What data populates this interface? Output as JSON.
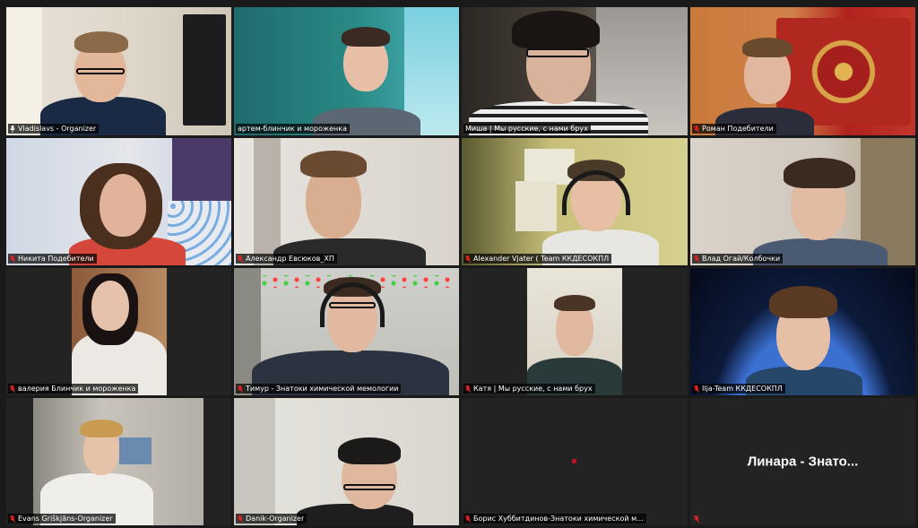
{
  "meeting": {
    "view": "gallery",
    "participants": [
      {
        "name": "Vladislavs - Organizer",
        "mic": "on"
      },
      {
        "name": "артем-блинчик и мороженка",
        "mic": "none"
      },
      {
        "name": "Миша | Мы русские, с нами брух",
        "mic": "none",
        "active_speaker": true
      },
      {
        "name": "Роман Подебители",
        "mic": "muted"
      },
      {
        "name": "Никита Подебители",
        "mic": "muted"
      },
      {
        "name": "Александр Евсюков_ХП",
        "mic": "muted"
      },
      {
        "name": "Alexander Vjater ( Team ККДЕСОКПЛ",
        "mic": "muted"
      },
      {
        "name": "Влад Огай/Колбочки",
        "mic": "muted"
      },
      {
        "name": "валерия Блинчик и мороженка",
        "mic": "muted"
      },
      {
        "name": "Тимур - Знатоки химической мемологии",
        "mic": "muted"
      },
      {
        "name": "Катя | Мы русские, с нами брух",
        "mic": "muted"
      },
      {
        "name": "Ilja-Team ККДЕСОКПЛ",
        "mic": "muted"
      },
      {
        "name": "Evans Griškjāns-Organizer",
        "mic": "muted"
      },
      {
        "name": "Danik-Organizer",
        "mic": "muted"
      },
      {
        "name": "Борис Хуббитдинов-Знатоки химической м...",
        "mic": "muted"
      },
      {
        "name": "",
        "mic": "muted",
        "camera_off_label": "Линара - Знато..."
      }
    ]
  },
  "colors": {
    "background": "#1a1a1a",
    "active_speaker_border": "#d6e64a",
    "muted_icon": "#e02424"
  }
}
